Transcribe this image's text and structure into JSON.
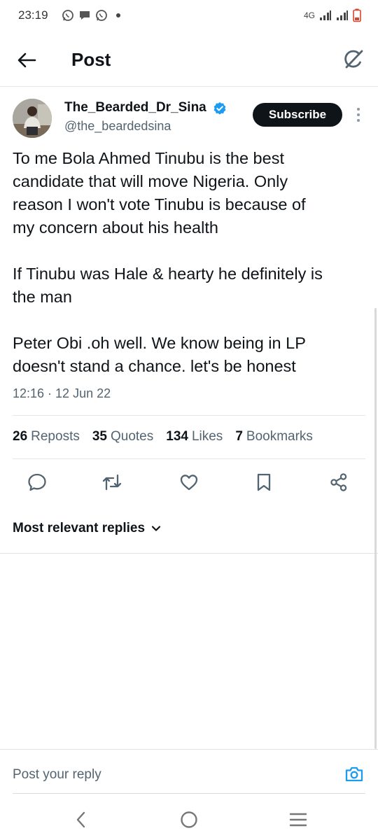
{
  "status_bar": {
    "time": "23:19",
    "network": "4G",
    "icons": [
      "whatsapp-icon",
      "chat-icon",
      "whatsapp-icon",
      "dot-icon",
      "signal-icon",
      "signal-icon",
      "battery-icon"
    ]
  },
  "header": {
    "title": "Post",
    "back_icon": "arrow-left-icon",
    "grok_icon": "grok-icon"
  },
  "post": {
    "author_name": "The_Bearded_Dr_Sina",
    "handle": "@the_beardedsina",
    "subscribe_label": "Subscribe",
    "lines": [
      "To me Bola Ahmed Tinubu is the best",
      "candidate that will move Nigeria. Only",
      "reason I won't vote Tinubu is because of",
      "my concern about his health",
      "If Tinubu was Hale & hearty he definitely is",
      "the man",
      "Peter Obi .oh well. We know being in LP",
      "doesn't stand a chance. let's be honest"
    ],
    "timestamp": "12:16 · 12 Jun 22"
  },
  "stats": [
    {
      "count": "26",
      "label": "Reposts"
    },
    {
      "count": "35",
      "label": "Quotes"
    },
    {
      "count": "134",
      "label": "Likes"
    },
    {
      "count": "7",
      "label": "Bookmarks"
    }
  ],
  "actions": [
    "reply-icon",
    "repost-icon",
    "like-icon",
    "bookmark-icon",
    "share-icon"
  ],
  "replies": {
    "sort_label": "Most relevant replies"
  },
  "reply_bar": {
    "placeholder": "Post your reply"
  },
  "colors": {
    "text": "#0f1419",
    "secondary": "#536471",
    "accent": "#1d9bf0",
    "subscribe_bg": "#0f1419"
  }
}
